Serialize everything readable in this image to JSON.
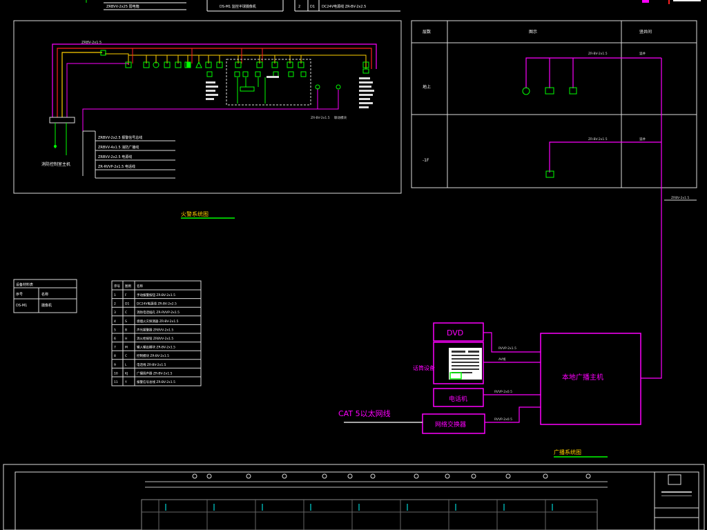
{
  "top_strip": {
    "left_cell": "ZRBVV-2x25   弱电箱",
    "mid_cell": "DS-M1   监控半球摄像机",
    "right_num": "2",
    "right_code": "D1",
    "right_text": "DC24V电源线   ZR-BV-2x2.5"
  },
  "fire_diagram": {
    "bus_label": "ZRBV-2x1.5",
    "cable_rows": [
      "ZRBVV-2x2.5  报警信号总线",
      "ZRBVV-4x1.5  消防广播线",
      "ZRBVV-2x2.5  电源线",
      "ZR-RVVP-2x1.5  电话线"
    ],
    "panel_label": "消防控制室主机",
    "feed_labels": [
      "ZR-BV-2x1.5",
      "联动模块"
    ]
  },
  "fire_title": "火警系统图",
  "broadcast_table": {
    "headers": [
      "层数",
      "图示",
      "竖井间"
    ],
    "rows": [
      {
        "floor": "地上",
        "cable": "ZR-BV-2x1.5",
        "shaft": "竖井"
      },
      {
        "floor": "-1F",
        "cable": "ZR-BV-2x1.5",
        "shaft": "竖井"
      }
    ],
    "riser_label": "ZRBV-2x1.5"
  },
  "legend_small": {
    "header": "设备材料表",
    "rows": [
      [
        "序号",
        "名称"
      ],
      [
        "DS-M1",
        "摄像机"
      ]
    ]
  },
  "legend_main": {
    "headers": [
      "序号",
      "图例",
      "名称"
    ],
    "rows": [
      [
        "1",
        "F",
        "手动报警按钮   ZR-BV-2x1.5"
      ],
      [
        "2",
        "D1",
        "DC24V电源线   ZR-BV-2x2.5"
      ],
      [
        "3",
        "C",
        "消防电话插孔   ZR-RVVP-2x1.5"
      ],
      [
        "4",
        "S",
        "感烟火灾探测器   ZR-BV-2x1.5"
      ],
      [
        "5",
        "B",
        "声光报警器   ZRBVV-2x1.5"
      ],
      [
        "6",
        "H",
        "消火栓按钮   ZRBVV-2x1.5"
      ],
      [
        "7",
        "M",
        "输入输出模块   ZR-BV-2x1.5"
      ],
      [
        "8",
        "C",
        "控制模块   ZR-BV-2x1.5"
      ],
      [
        "9",
        "L",
        "电话线   ZR-BV-2x1.5"
      ],
      [
        "10",
        "KJ",
        "广播扬声器   ZR-BV-2x1.5"
      ],
      [
        "11",
        "Y",
        "报警信号总线   ZR-BV-2x1.5"
      ]
    ]
  },
  "broadcast": {
    "dvd": "DVD",
    "player_label": "话筒设备",
    "amplifier": "电话机",
    "network_switch": "网络交换器",
    "host": "本地广播主机",
    "cat5": "CAT 5以太网线",
    "link_labels": [
      "RVVP-2x1.5",
      "AV线",
      "RVVP-2x0.5",
      "RVVP-2x0.5"
    ]
  },
  "broadcast_title": "广播系统图",
  "colors": {
    "magenta": "#ff00ff",
    "green": "#00ff00",
    "yellow": "#ffff00",
    "red": "#ff2020",
    "white": "#ffffff",
    "cyan": "#00ffff"
  }
}
